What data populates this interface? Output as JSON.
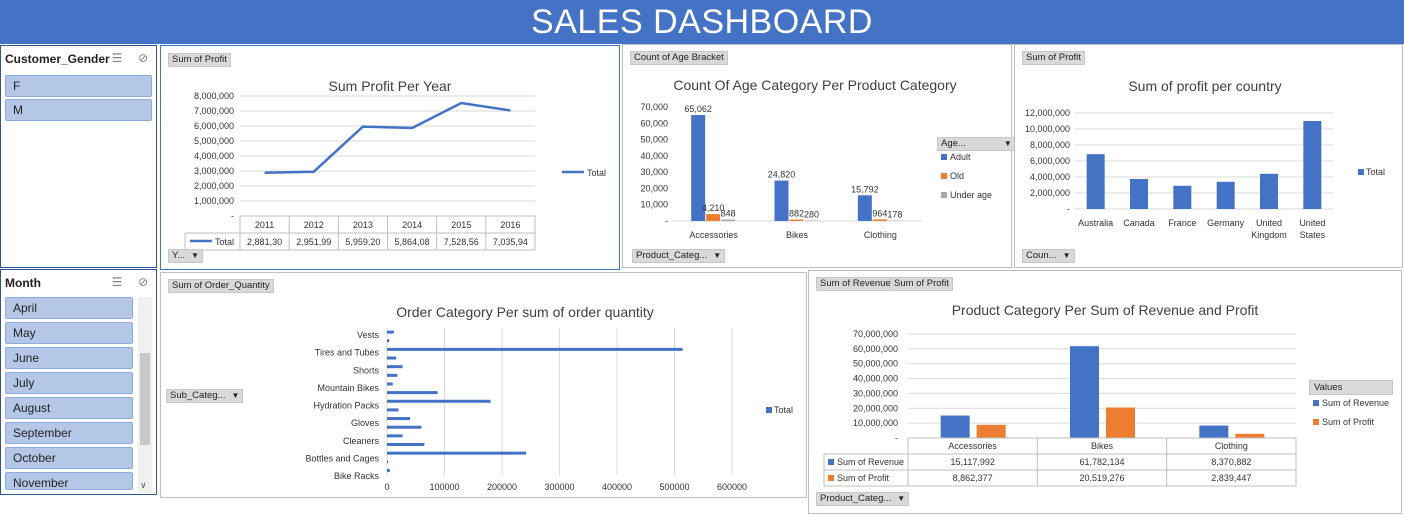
{
  "dashboard_title": "SALES DASHBOARD",
  "slicers": {
    "gender": {
      "title": "Customer_Gender",
      "items": [
        "F",
        "M"
      ]
    },
    "month": {
      "title": "Month",
      "items": [
        "April",
        "May",
        "June",
        "July",
        "August",
        "September",
        "October",
        "November"
      ]
    }
  },
  "icons": {
    "multiselect": "multi-select-icon",
    "clear_filter": "clear-filter-icon",
    "dropdown": "dropdown-arrow-icon"
  },
  "colors": {
    "blue": "#4472c4",
    "orange": "#ed7d31",
    "grey": "#a5a5a5",
    "banner": "#4472c4",
    "slicer_item": "#b4c7e7"
  },
  "field_tags": {
    "profit_year": "Sum of Profit",
    "age_bracket": "Count of Age Bracket",
    "profit_country": "Sum of Profit",
    "order_quantity": "Sum of Order_Quantity",
    "revenue": "Sum of Revenue",
    "profit": "Sum of Profit"
  },
  "dropdowns": {
    "year": "Y...",
    "product_category_age": "Product_Categ...",
    "age_legend": "Age...",
    "country": "Coun...",
    "sub_category": "Sub_Categ...",
    "product_category_rev": "Product_Categ...",
    "values_legend": "Values"
  },
  "chart_data": [
    {
      "id": "profit_per_year",
      "type": "line",
      "title": "Sum Profit Per Year",
      "categories": [
        "2011",
        "2012",
        "2013",
        "2014",
        "2015",
        "2016"
      ],
      "series": [
        {
          "name": "Total",
          "values": [
            2881300,
            2951990,
            5959200,
            5864080,
            7528560,
            7035940
          ]
        }
      ],
      "table_values": [
        "2,881,30",
        "2,951,99",
        "5,959,20",
        "5,864,08",
        "7,528,56",
        "7,035,94"
      ],
      "yticks": [
        "-",
        "1,000,000",
        "2,000,000",
        "3,000,000",
        "4,000,000",
        "5,000,000",
        "6,000,000",
        "7,000,000",
        "8,000,000"
      ],
      "ylim": [
        0,
        8000000
      ],
      "grid": true,
      "legend": "right"
    },
    {
      "id": "age_per_product",
      "type": "bar",
      "title": "Count Of Age Category Per Product Category",
      "categories": [
        "Accessories",
        "Bikes",
        "Clothing"
      ],
      "series": [
        {
          "name": "Adult",
          "values": [
            65062,
            24820,
            15792
          ]
        },
        {
          "name": "Old",
          "values": [
            4210,
            882,
            964
          ]
        },
        {
          "name": "Under age",
          "values": [
            848,
            280,
            178
          ]
        }
      ],
      "data_labels": [
        [
          "65,062",
          "24,820",
          "15,792"
        ],
        [
          "4,210",
          "882",
          "964"
        ],
        [
          "848",
          "280",
          "178"
        ]
      ],
      "yticks": [
        "-",
        "10,000",
        "20,000",
        "30,000",
        "40,000",
        "50,000",
        "60,000",
        "70,000"
      ],
      "ylim": [
        0,
        70000
      ],
      "grid": false,
      "legend": "right"
    },
    {
      "id": "profit_per_country",
      "type": "bar",
      "title": "Sum of profit per country",
      "categories": [
        "Australia",
        "Canada",
        "France",
        "Germany",
        "United Kingdom",
        "United States"
      ],
      "series": [
        {
          "name": "Total",
          "values": [
            6850000,
            3750000,
            2900000,
            3400000,
            4400000,
            11000000
          ]
        }
      ],
      "yticks": [
        "-",
        "2,000,000",
        "4,000,000",
        "6,000,000",
        "8,000,000",
        "10,000,000",
        "12,000,000"
      ],
      "ylim": [
        0,
        12000000
      ],
      "grid": true,
      "legend": "right"
    },
    {
      "id": "order_per_subcategory",
      "type": "bar",
      "orientation": "horizontal",
      "title": "Order Category Per sum of order quantity",
      "categories": [
        "Vests",
        "Tires and Tubes",
        "Shorts",
        "Mountain Bikes",
        "Hydration Packs",
        "Gloves",
        "Cleaners",
        "Bottles and Cages",
        "Bike Racks"
      ],
      "series": [
        {
          "name": "Total",
          "values": [
            12000,
            4000,
            514000,
            16000,
            27000,
            18000,
            10000,
            88000,
            180000,
            20000,
            40000,
            60000,
            27000,
            65000,
            242000,
            2000,
            5000
          ]
        }
      ],
      "xticks": [
        "0",
        "100000",
        "200000",
        "300000",
        "400000",
        "500000",
        "600000"
      ],
      "xlim": [
        0,
        600000
      ],
      "grid": true,
      "legend": "right"
    },
    {
      "id": "revenue_profit_per_product",
      "type": "bar",
      "title": "Product Category Per Sum of Revenue and Profit",
      "categories": [
        "Accessories",
        "Bikes",
        "Clothing"
      ],
      "series": [
        {
          "name": "Sum of Revenue",
          "values": [
            15117992,
            61782134,
            8370882
          ]
        },
        {
          "name": "Sum of Profit",
          "values": [
            8862377,
            20519276,
            2839447
          ]
        }
      ],
      "table_values": [
        [
          "15,117,992",
          "61,782,134",
          "8,370,882"
        ],
        [
          "8,862,377",
          "20,519,276",
          "2,839,447"
        ]
      ],
      "yticks": [
        "-",
        "10,000,000",
        "20,000,000",
        "30,000,000",
        "40,000,000",
        "50,000,000",
        "60,000,000",
        "70,000,000"
      ],
      "ylim": [
        0,
        70000000
      ],
      "grid": true,
      "legend": "right"
    }
  ]
}
